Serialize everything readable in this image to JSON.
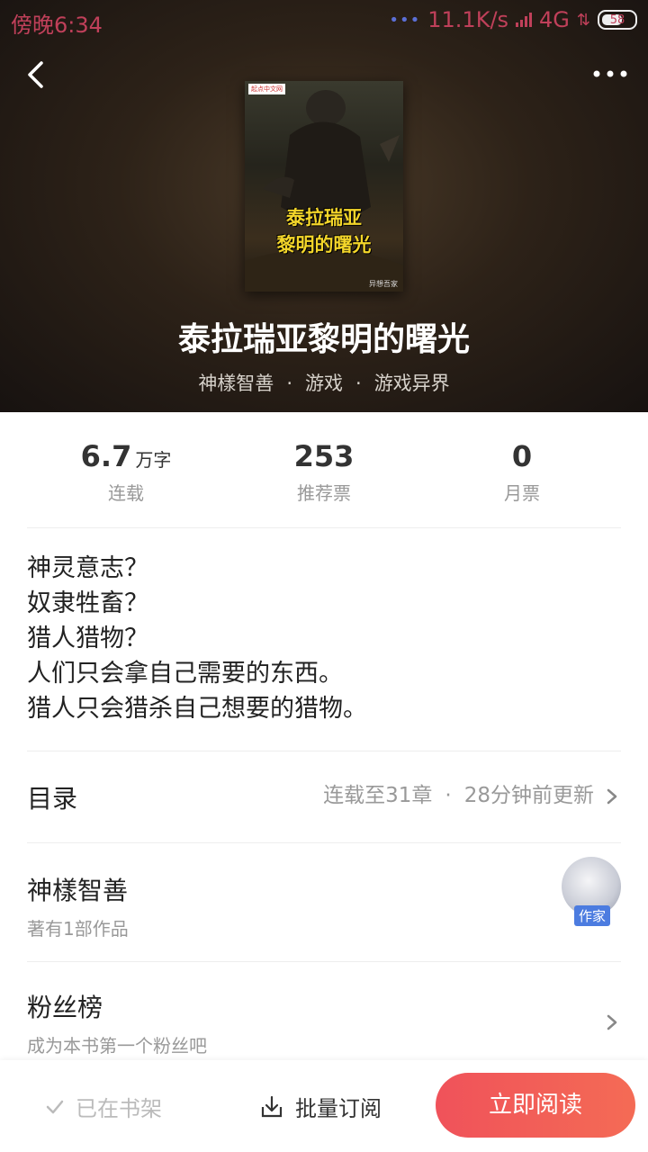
{
  "status_bar": {
    "time": "傍晚6:34",
    "network_speed": "11.1K/s",
    "network_type": "4G",
    "battery": "58"
  },
  "book": {
    "cover_title_line1": "泰拉瑞亚",
    "cover_title_line2": "黎明的曙光",
    "cover_badge": "起点中文网",
    "cover_author": "异想吾家",
    "title": "泰拉瑞亚黎明的曙光",
    "author": "神樣智善",
    "category": "游戏",
    "subcategory": "游戏异界",
    "meta_separator": "·"
  },
  "stats": [
    {
      "value": "6.7",
      "unit": "万字",
      "label": "连载"
    },
    {
      "value": "253",
      "unit": "",
      "label": "推荐票"
    },
    {
      "value": "0",
      "unit": "",
      "label": "月票"
    }
  ],
  "intro": [
    "神灵意志？",
    "奴隶牲畜？",
    "猎人猎物？",
    "人们只会拿自己需要的东西。",
    "猎人只会猎杀自己想要的猎物。"
  ],
  "catalog": {
    "label": "目录",
    "status": "连载至31章",
    "separator": "·",
    "updated": "28分钟前更新"
  },
  "author_section": {
    "name": "神樣智善",
    "works": "著有1部作品",
    "badge": "作家"
  },
  "fans": {
    "label": "粉丝榜",
    "sub": "成为本书第一个粉丝吧"
  },
  "bottom_bar": {
    "shelf_label": "已在书架",
    "batch_label": "批量订阅",
    "read_label": "立即阅读"
  },
  "colors": {
    "accent": "#f0525a",
    "badge_blue": "#4c7ce0",
    "status_red": "#c0405a"
  },
  "icons": [
    "back-icon",
    "more-icon",
    "chevron-right-icon",
    "check-icon",
    "download-icon"
  ]
}
